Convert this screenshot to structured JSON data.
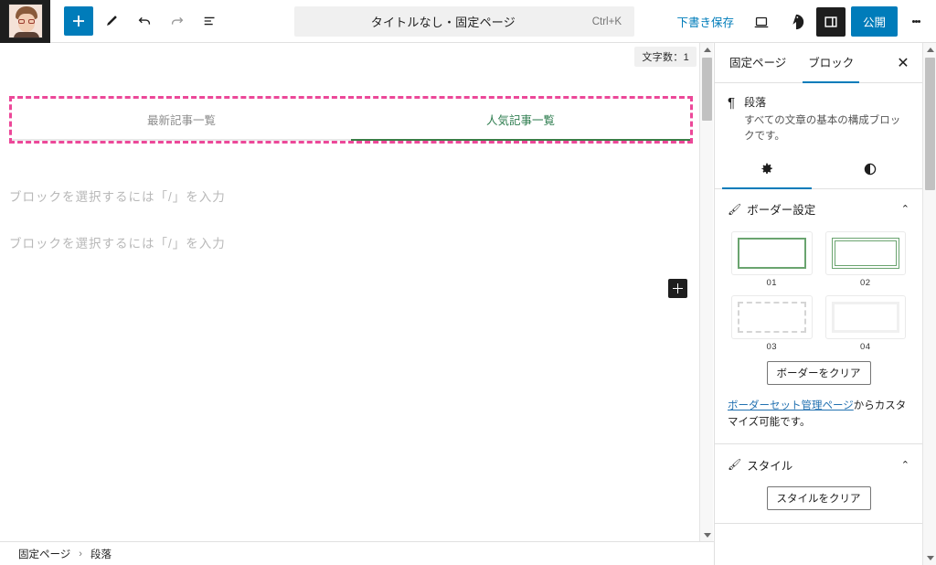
{
  "topbar": {
    "avatar_name": "user-avatar",
    "tools": [
      {
        "name": "block-inserter-toggle",
        "icon": "plus-icon",
        "label": "+"
      },
      {
        "name": "tools-edit",
        "icon": "pencil-icon",
        "label": ""
      },
      {
        "name": "undo-button",
        "icon": "undo-arrow-icon",
        "label": ""
      },
      {
        "name": "redo-button",
        "icon": "redo-arrow-icon",
        "label": ""
      },
      {
        "name": "list-view-button",
        "icon": "list-view-icon",
        "label": ""
      }
    ],
    "document_title": "タイトルなし・固定ページ",
    "shortcut": "Ctrl+K",
    "save_draft_label": "下書き保存",
    "preview_icon": "laptop-preview-icon",
    "jetpack_icon": "jetpack-icon",
    "settings_toggle_icon": "sidebar-toggle-icon",
    "publish_label": "公開",
    "options_icon": "kebab-menu-icon"
  },
  "editor": {
    "char_count_badge": "文字数：1",
    "selected_block": {
      "tabs": [
        {
          "label": "最新記事一覧",
          "state": "inactive"
        },
        {
          "label": "人気記事一覧",
          "state": "active"
        }
      ],
      "selection_color": "#ec4899",
      "active_tab_color": "#2e7d4f"
    },
    "paragraph_placeholders": [
      "ブロックを選択するには「/」を入力",
      "ブロックを選択するには「/」を入力"
    ],
    "inserter_icon": "plus-icon"
  },
  "sidebar": {
    "tabs": [
      {
        "label": "固定ページ",
        "active": false
      },
      {
        "label": "ブロック",
        "active": true
      }
    ],
    "close_icon": "close-icon",
    "block": {
      "icon": "pilcrow-icon",
      "name": "段落",
      "description": "すべての文章の基本の構成ブロックです。"
    },
    "icon_tabs": [
      {
        "name": "settings-tab",
        "icon": "gear-icon",
        "glyph": "✿",
        "active": true
      },
      {
        "name": "styles-tab",
        "icon": "contrast-icon",
        "glyph": "◐",
        "active": false
      }
    ],
    "border_panel": {
      "title": "ボーダー設定",
      "icon": "brush-icon",
      "chevron": "chevron-up-icon",
      "presets": [
        {
          "label": "01",
          "style": "solid-green"
        },
        {
          "label": "02",
          "style": "double-green"
        },
        {
          "label": "03",
          "style": "dashed-gray"
        },
        {
          "label": "04",
          "style": "solid-light"
        }
      ],
      "clear_button": "ボーダーをクリア",
      "note_link": "ボーダーセット管理ページ",
      "note_rest": "からカスタマイズ可能です。"
    },
    "style_panel": {
      "title": "スタイル",
      "icon": "brush-icon",
      "chevron": "chevron-up-icon",
      "clear_button": "スタイルをクリア"
    }
  },
  "breadcrumb": {
    "items": [
      "固定ページ",
      "段落"
    ],
    "separator": "›"
  },
  "colors": {
    "accent": "#007cba",
    "selection": "#ec4899",
    "tab_green": "#2e7d4f",
    "dark": "#1e1e1e"
  }
}
